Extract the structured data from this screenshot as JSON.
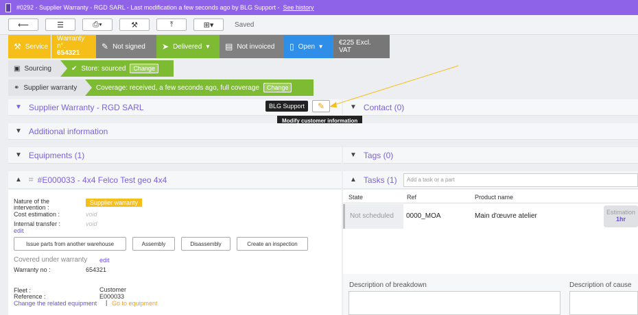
{
  "topbar": {
    "title": "#0292  -  Supplier Warranty - RGD SARL  -  Last modification a few seconds ago by BLG Support  -",
    "history_link": "See history"
  },
  "toolbar": {
    "saved": "Saved"
  },
  "status": {
    "service": "Service",
    "warranty_label": "Warranty n°.",
    "warranty_no": "654321",
    "not_signed": "Not signed",
    "delivered": "Delivered",
    "not_invoiced": "Not invoiced",
    "open": "Open",
    "price": "€225 Excl. VAT",
    "colors": {
      "service": "#f5be18",
      "signed": "#808080",
      "delivered": "#7dbb32",
      "invoiced": "#808080",
      "open": "#2e8ee8",
      "price": "#777777"
    }
  },
  "flows": {
    "sourcing_label": "Sourcing",
    "sourcing_status": "Store: sourced",
    "sourcing_change": "Change",
    "supplier_label": "Supplier warranty",
    "supplier_status": "Coverage: received, a few seconds ago, full coverage",
    "supplier_change": "Change"
  },
  "sections": {
    "supplier": "Supplier Warranty - RGD SARL",
    "blg_tag": "BLG Support",
    "tooltip": "Modify customer information",
    "contact": "Contact (0)",
    "additional": "Additional information",
    "equipments": "Equipments (1)",
    "tags": "Tags (0)",
    "equipment_item": "#E000033 - 4x4 Felco Test geo 4x4",
    "tasks": "Tasks (1)",
    "task_placeholder": "Add a task or a part"
  },
  "equipment": {
    "nature_label": "Nature of the intervention :",
    "nature_value": "Supplier warranty",
    "cost_label": "Cost estimation :",
    "cost_value": "void",
    "transfer_label": "Internal transfer :",
    "transfer_value": "void",
    "edit": "edit",
    "buttons": [
      "Issue parts from another warehouse",
      "Assembly",
      "Disassembly",
      "Create an inspection"
    ],
    "covered": "Covered under warranty",
    "covered_edit": "edit",
    "warranty_no_label": "Warranty no :",
    "warranty_no_value": "654321",
    "fleet_label": "Fleet :",
    "fleet_value": "Customer",
    "reference_label": "Reference :",
    "reference_value": "E000033",
    "change_equipment": "Change the related equipment",
    "separator": "|",
    "go_to": "Go to equipment"
  },
  "tasks_table": {
    "headers": [
      "State",
      "Ref",
      "Product name"
    ],
    "row": {
      "state": "Not scheduled",
      "ref": "0000_MOA",
      "product": "Main d'œuvre atelier",
      "estimation_label": "Estimation",
      "estimation_value": "1hr"
    },
    "desc_breakdown": "Description of breakdown",
    "desc_cause": "Description of cause"
  }
}
